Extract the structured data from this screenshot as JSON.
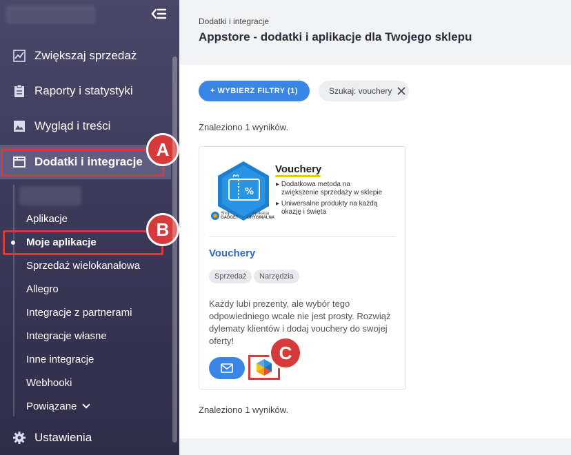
{
  "sidebar": {
    "items": [
      {
        "label": "Zwiększaj sprzedaż",
        "icon": "chart-icon"
      },
      {
        "label": "Raporty i statystyki",
        "icon": "clipboard-icon"
      },
      {
        "label": "Wygląd i treści",
        "icon": "image-icon"
      },
      {
        "label": "Dodatki i integracje",
        "icon": "window-icon"
      }
    ],
    "subitems": [
      "Aplikacje",
      "Moje aplikacje",
      "Sprzedaż wielokanałowa",
      "Allegro",
      "Integracje z partnerami",
      "Integracje własne",
      "Inne integracje",
      "Webhooki",
      "Powiązane"
    ],
    "settings_label": "Ustawienia"
  },
  "annotations": {
    "a": "A",
    "b": "B",
    "c": "C"
  },
  "header": {
    "breadcrumb": "Dodatki i integracje",
    "title": "Appstore - dodatki i aplikacje dla Twojego sklepu"
  },
  "filters": {
    "button_label": "+ WYBIERZ FILTRY (1)",
    "chip_label": "Szukaj: vouchery"
  },
  "results": {
    "found_text": "Znaleziono 1 wyników."
  },
  "card": {
    "banner": {
      "title": "Vouchery",
      "bullet1_line1": "Dodatkowa metoda na",
      "bullet1_line2": "zwiększenie sprzedaży w sklepie",
      "bullet2_line1": "Uniwersalne produkty na każdą",
      "bullet2_line2": "okazję i święta",
      "brand_line1": "Shop",
      "brand_line2": "GADGET",
      "badge_line1": "Aplikacja",
      "badge_line2": "ORYGINALNA"
    },
    "title": "Vouchery",
    "tags": [
      "Sprzedaż",
      "Narzędzia"
    ],
    "description": "Każdy lubi prezenty, ale wybór tego odpowiedniego wcale nie jest prosty. Rozwiąż dylematy klientów i dodaj vouchery do swojej oferty!"
  },
  "colors": {
    "accent": "#3a86e6",
    "annotation": "#d63a3a",
    "sidebar": "#3a3756",
    "link": "#2f6cc0"
  }
}
